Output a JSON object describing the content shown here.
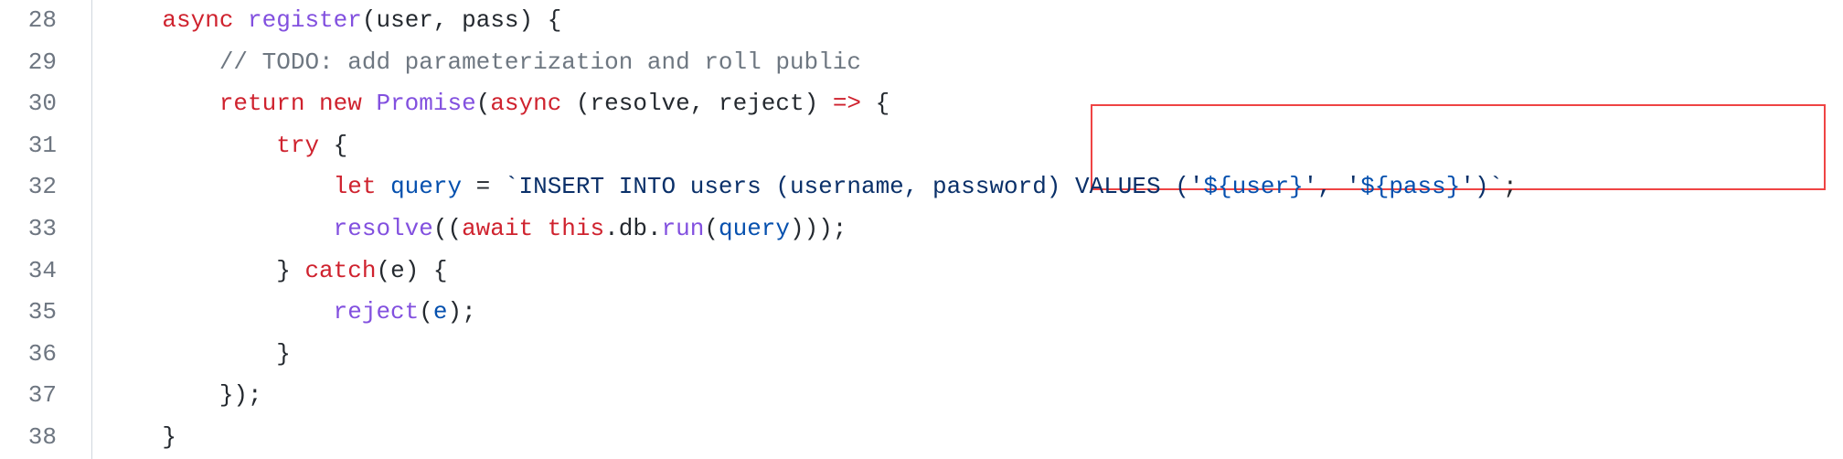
{
  "gutter": {
    "lines": [
      "28",
      "29",
      "30",
      "31",
      "32",
      "33",
      "34",
      "35",
      "36",
      "37",
      "38"
    ]
  },
  "code": {
    "l28": {
      "indent": "    ",
      "kw_async": "async",
      "fn_name": "register",
      "open_paren": "(",
      "p1": "user",
      "comma": ", ",
      "p2": "pass",
      "close_paren": ")",
      "brace": " {"
    },
    "l29": {
      "indent": "        ",
      "comment": "// TODO: add parameterization and roll public"
    },
    "l30": {
      "indent": "        ",
      "kw_return": "return",
      "kw_new": " new",
      "ctor": " Promise",
      "open": "(",
      "kw_async": "async",
      "args_open": " (",
      "a1": "resolve",
      "comma": ", ",
      "a2": "reject",
      "args_close": ")",
      "arrow": " => ",
      "brace": "{"
    },
    "l31": {
      "indent": "            ",
      "kw_try": "try",
      "brace": " {"
    },
    "l32": {
      "indent": "                ",
      "kw_let": "let",
      "sp": " ",
      "var_query": "query",
      "eq": " = ",
      "tick_open": "`",
      "sql_a": "INSERT INTO users (username, password) VALUES ('",
      "int1_open": "${",
      "int1_var": "user",
      "int1_close": "}",
      "sql_b": "', '",
      "int2_open": "${",
      "int2_var": "pass",
      "int2_close": "}",
      "sql_c": "')",
      "tick_close": "`",
      "semi": ";"
    },
    "l33": {
      "indent": "                ",
      "fn_resolve": "resolve",
      "open1": "((",
      "kw_await": "await",
      "sp": " ",
      "this": "this",
      "dot1": ".",
      "db": "db",
      "dot2": ".",
      "run": "run",
      "open2": "(",
      "arg": "query",
      "close": ")));"
    },
    "l34": {
      "indent": "            ",
      "close_brace": "}",
      "kw_catch": " catch",
      "open": "(",
      "e": "e",
      "close": ")",
      "brace": " {"
    },
    "l35": {
      "indent": "                ",
      "fn_reject": "reject",
      "open": "(",
      "e": "e",
      "close": ");"
    },
    "l36": {
      "indent": "            ",
      "brace": "}"
    },
    "l37": {
      "indent": "        ",
      "close": "});"
    },
    "l38": {
      "indent": "    ",
      "brace": "}"
    }
  },
  "highlight": {
    "top_px": "114",
    "left_px": "1103",
    "width_px": "804",
    "height_px": "94"
  }
}
